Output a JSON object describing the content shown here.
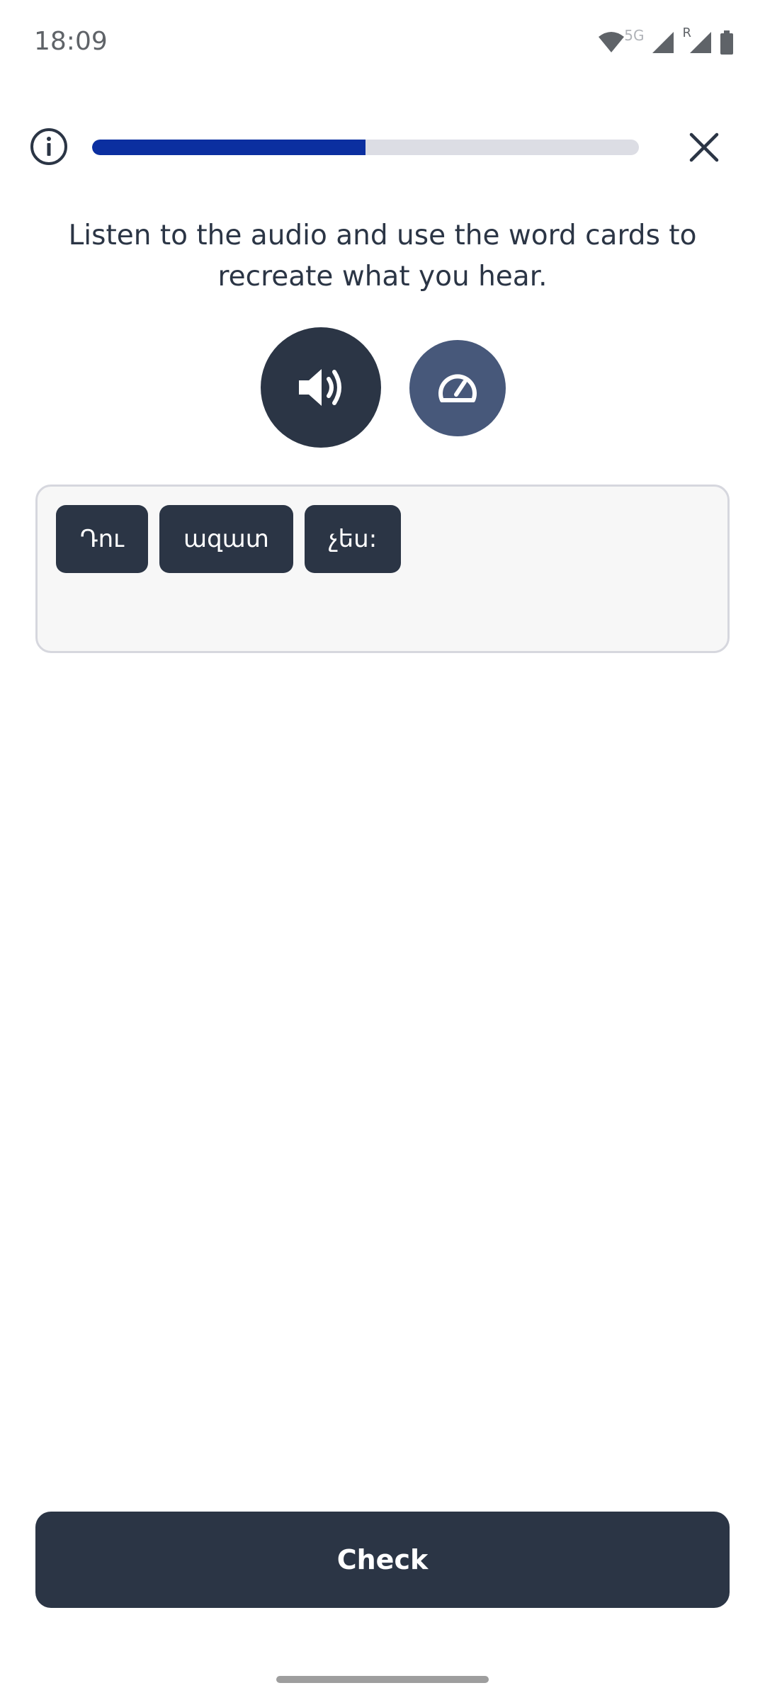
{
  "status_bar": {
    "time": "18:09",
    "network_label": "5G",
    "roaming_label": "R",
    "icons": [
      "wifi-icon",
      "signal-icon",
      "signal-roaming-icon",
      "battery-icon"
    ]
  },
  "top_bar": {
    "info_icon": "info-circle-icon",
    "close_icon": "close-icon",
    "progress_fraction": 0.5
  },
  "exercise": {
    "instruction": "Listen to the audio and use the word cards to recreate what you hear.",
    "play_icon": "speaker-icon",
    "slow_icon": "speedometer-icon",
    "selected_words": [
      "Դու",
      "ազատ",
      "չես:"
    ]
  },
  "actions": {
    "check_label": "Check"
  },
  "colors": {
    "primary_dark": "#2b3545",
    "progress_fill": "#0b2fa0",
    "progress_track": "#dcdde4",
    "slow_button": "#47587a"
  }
}
